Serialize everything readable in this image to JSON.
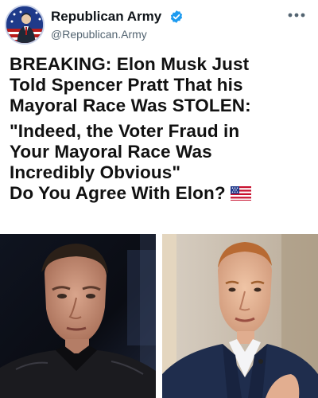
{
  "account": {
    "display_name": "Republican Army",
    "handle": "@Republican.Army"
  },
  "icons": {
    "avatar": "patriot-figure-avatar",
    "verified": "verified-badge-icon",
    "more": "more-options-icon",
    "flag": "us-flag-emoji"
  },
  "post": {
    "line1": "BREAKING: Elon Musk Just",
    "line2": "Told Spencer Pratt That his",
    "line3": "Mayoral Race Was STOLEN:",
    "line4": "\"Indeed, the Voter Fraud in",
    "line5": "Your Mayoral Race Was",
    "line6": "Incredibly Obvious\"",
    "line7": "Do You Agree With Elon?"
  },
  "colors": {
    "verified_blue": "#1d9bf0",
    "text_primary": "#0f1419",
    "text_secondary": "#536471"
  }
}
